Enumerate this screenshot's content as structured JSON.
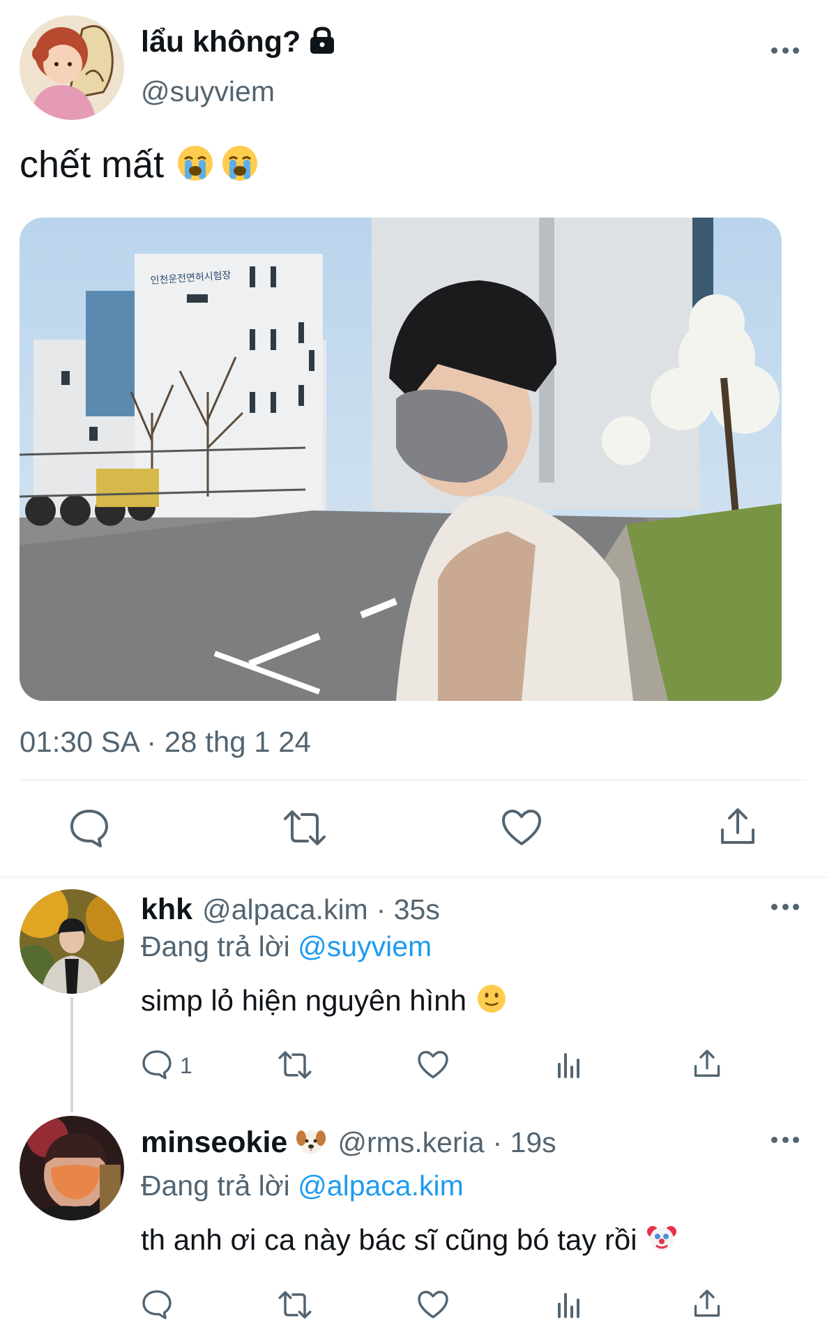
{
  "main_tweet": {
    "display_name": "lẩu không?",
    "handle": "@suyviem",
    "text": "chết mất",
    "emoji": [
      "loudly-crying-face",
      "loudly-crying-face"
    ],
    "timestamp": "01:30 SA · 28 thg 1 24",
    "photo_sign_text": "인천운전면허시험장"
  },
  "replies": [
    {
      "display_name": "khk",
      "handle": "@alpaca.kim",
      "time": "· 35s",
      "replying_prefix": "Đang trả lời",
      "replying_to": "@suyviem",
      "text": "simp lỏ hiện nguyên hình",
      "emoji": "slightly-smiling-face",
      "reply_count": "1"
    },
    {
      "display_name": "minseokie",
      "name_emoji": "dog-face",
      "handle": "@rms.keria",
      "time": "· 19s",
      "replying_prefix": "Đang trả lời",
      "replying_to": "@alpaca.kim",
      "text": "th anh ơi ca này bác sĩ cũng bó tay rồi",
      "emoji": "clown-face",
      "reply_count": ""
    }
  ],
  "colors": {
    "text_primary": "#0f1419",
    "text_secondary": "#536471",
    "link": "#1d9bf0",
    "divider": "#eff3f4"
  }
}
